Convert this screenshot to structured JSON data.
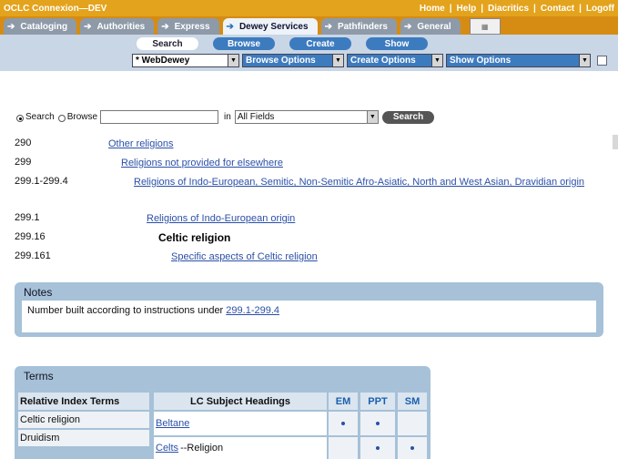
{
  "header": {
    "app_title": "OCLC Connexion—DEV",
    "links": [
      "Home",
      "Help",
      "Diacritics",
      "Contact",
      "Logoff"
    ]
  },
  "tabs": [
    {
      "label": "Cataloging",
      "active": false
    },
    {
      "label": "Authorities",
      "active": false
    },
    {
      "label": "Express",
      "active": false
    },
    {
      "label": "Dewey Services",
      "active": true
    },
    {
      "label": "Pathfinders",
      "active": false
    },
    {
      "label": "General",
      "active": false
    }
  ],
  "subnav": {
    "pills": [
      "Search",
      "Browse",
      "Create",
      "Show"
    ],
    "active_pill": "Search",
    "selects": [
      "* WebDewey",
      "Browse Options",
      "Create Options",
      "Show Options"
    ]
  },
  "search": {
    "radio_search": "Search",
    "radio_browse": "Browse",
    "input_value": "",
    "in_label": "in",
    "field_value": "All Fields",
    "button": "Search"
  },
  "hierarchy": [
    {
      "number": "290",
      "caption": "Other religions",
      "level": 0,
      "current": false
    },
    {
      "number": "299",
      "caption": "Religions not provided for elsewhere",
      "level": 1,
      "current": false
    },
    {
      "number": "299.1-299.4",
      "caption": "Religions of Indo-European, Semitic, Non-Semitic Afro-Asiatic, North and West Asian, Dravidian origin",
      "level": 2,
      "current": false
    },
    {
      "number": "299.1",
      "caption": "Religions of Indo-European origin",
      "level": 3,
      "current": false
    },
    {
      "number": "299.16",
      "caption": "Celtic religion",
      "level": 4,
      "current": true
    },
    {
      "number": "299.161",
      "caption": "Specific aspects of Celtic religion",
      "level": 5,
      "current": false
    }
  ],
  "notes": {
    "title": "Notes",
    "text": "Number built according to instructions under",
    "link": "299.1-299.4"
  },
  "terms": {
    "title": "Terms",
    "headers": [
      "Relative Index Terms",
      "LC Subject Headings",
      "EM",
      "PPT",
      "SM"
    ],
    "relative_index": [
      "Celtic religion",
      "Druidism"
    ],
    "lcsh": [
      {
        "heading": "Beltane",
        "suffix": "",
        "em": true,
        "ppt": true,
        "sm": false
      },
      {
        "heading": "Celts",
        "suffix": "--Religion",
        "em": false,
        "ppt": true,
        "sm": true
      }
    ]
  },
  "colors": {
    "header": "#e3a31c",
    "tabbar": "#d68c12",
    "subnav": "#c8d6e6",
    "pill": "#3d7bbf",
    "panel": "#a6c1d8",
    "link": "#2b50a8"
  }
}
